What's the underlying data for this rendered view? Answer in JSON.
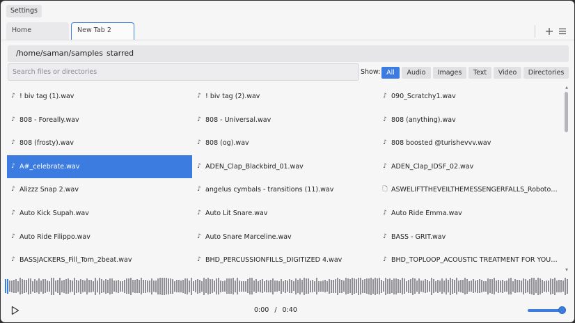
{
  "topbar": {
    "settings_label": "Settings"
  },
  "tabs": [
    {
      "label": "Home"
    },
    {
      "label": "New Tab 2"
    }
  ],
  "tab_actions": {
    "add_icon": "plus-icon",
    "menu_icon": "hamburger-menu-icon"
  },
  "pathbar": {
    "path": "/home/saman/samples",
    "starred_label": "starred"
  },
  "search": {
    "placeholder": "Search files or directories"
  },
  "filters": {
    "label": "Show:",
    "options": [
      "All",
      "Audio",
      "Images",
      "Text",
      "Video",
      "Directories"
    ],
    "active": "All"
  },
  "files": [
    [
      "! biv tag (1).wav",
      "! biv tag (2).wav",
      "090_Scratchy1.wav"
    ],
    [
      "808 - Foreally.wav",
      "808 - Universal.wav",
      "808 (anything).wav"
    ],
    [
      "808 (frosty).wav",
      "808 (og).wav",
      "808 boosted @turishevvv.wav"
    ],
    [
      "A#_celebrate.wav",
      "ADEN_Clap_Blackbird_01.wav",
      "ADEN_Clap_IDSF_02.wav"
    ],
    [
      "Alizzz Snap 2.wav",
      "angelus cymbals - transitions (11).wav",
      "ASWELIFTTHEVEILTHEMESSENGERFALLS_Robotoid.W..."
    ],
    [
      "Auto Kick Supah.wav",
      "Auto Lit Snare.wav",
      "Auto Ride Emma.wav"
    ],
    [
      "Auto Ride Filippo.wav",
      "Auto Snare Marceline.wav",
      "BASS - GRIT.wav"
    ],
    [
      "BASSJACKERS_Fill_Tom_2beat.wav",
      "BHD_PERCUSSIONFILLS_DIGITIZED 4.wav",
      "BHD_TOPLOOP_ACOUSTIC TREATMENT FOR YOUR E..."
    ]
  ],
  "file_icons": [
    [
      "music-note-icon",
      "music-note-icon",
      "music-note-icon"
    ],
    [
      "music-note-icon",
      "music-note-icon",
      "music-note-icon"
    ],
    [
      "music-note-icon",
      "music-note-icon",
      "music-note-icon"
    ],
    [
      "music-note-icon",
      "music-note-icon",
      "music-note-icon"
    ],
    [
      "music-note-icon",
      "music-note-icon",
      "document-icon"
    ],
    [
      "music-note-icon",
      "music-note-icon",
      "music-note-icon"
    ],
    [
      "music-note-icon",
      "music-note-icon",
      "music-note-icon"
    ],
    [
      "music-note-icon",
      "music-note-icon",
      "music-note-icon"
    ]
  ],
  "selected_file": "A#_celebrate.wav",
  "player": {
    "current_time": "0:00",
    "separator": "/",
    "total_time": "0:40",
    "progress": 0.0,
    "volume": 0.85,
    "play_icon": "play-icon"
  },
  "colors": {
    "accent": "#3c7be0",
    "background": "#f6f6f7"
  }
}
